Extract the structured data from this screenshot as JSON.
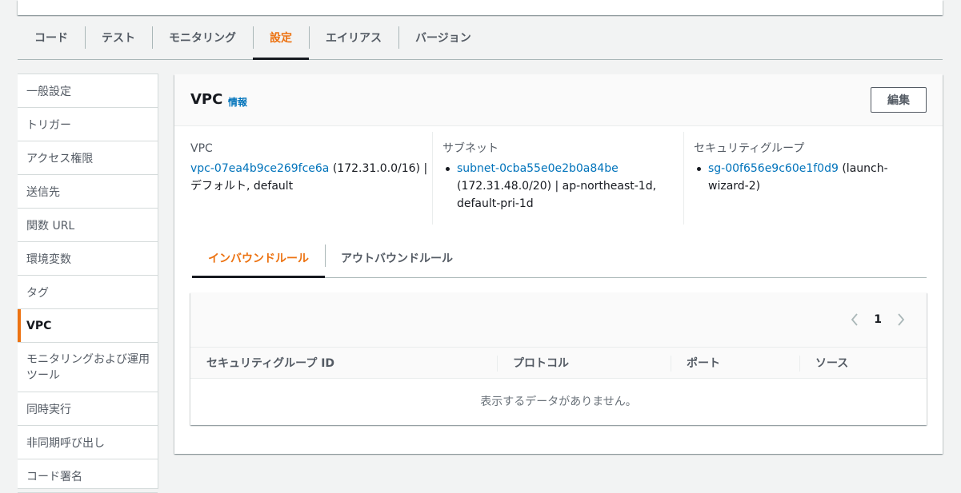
{
  "main_tabs": [
    {
      "label": "コード",
      "active": false
    },
    {
      "label": "テスト",
      "active": false
    },
    {
      "label": "モニタリング",
      "active": false
    },
    {
      "label": "設定",
      "active": true
    },
    {
      "label": "エイリアス",
      "active": false
    },
    {
      "label": "バージョン",
      "active": false
    }
  ],
  "side_nav": [
    {
      "label": "一般設定"
    },
    {
      "label": "トリガー"
    },
    {
      "label": "アクセス権限"
    },
    {
      "label": "送信先"
    },
    {
      "label": "関数 URL"
    },
    {
      "label": "環境変数"
    },
    {
      "label": "タグ"
    },
    {
      "label": "VPC",
      "active": true
    },
    {
      "label": "モニタリングおよび運用ツール"
    },
    {
      "label": "同時実行"
    },
    {
      "label": "非同期呼び出し"
    },
    {
      "label": "コード署名"
    }
  ],
  "panel": {
    "title": "VPC",
    "info_link": "情報",
    "edit_label": "編集"
  },
  "vpc": {
    "label": "VPC",
    "id": "vpc-07ea4b9ce269fce6a",
    "detail": " (172.31.0.0/16) | デフォルト, default"
  },
  "subnets": {
    "label": "サブネット",
    "items": [
      {
        "id": "subnet-0cba55e0e2b0a84be",
        "detail": "(172.31.48.0/20) | ap-northeast-1d, default-pri-1d"
      }
    ]
  },
  "security_groups": {
    "label": "セキュリティグループ",
    "items": [
      {
        "id": "sg-00f656e9c60e1f0d9",
        "detail": " (launch-wizard-2)"
      }
    ]
  },
  "rule_tabs": [
    {
      "label": "インバウンドルール",
      "active": true
    },
    {
      "label": "アウトバウンドルール",
      "active": false
    }
  ],
  "table": {
    "pager_page": "1",
    "columns": [
      "セキュリティグループ ID",
      "プロトコル",
      "ポート",
      "ソース"
    ],
    "empty_text": "表示するデータがありません。"
  },
  "colors": {
    "accent": "#ec7211",
    "link": "#0073bb",
    "text": "#16191f",
    "muted": "#545b64"
  },
  "icons": {
    "pager_prev": "chevron-left-icon",
    "pager_next": "chevron-right-icon"
  }
}
